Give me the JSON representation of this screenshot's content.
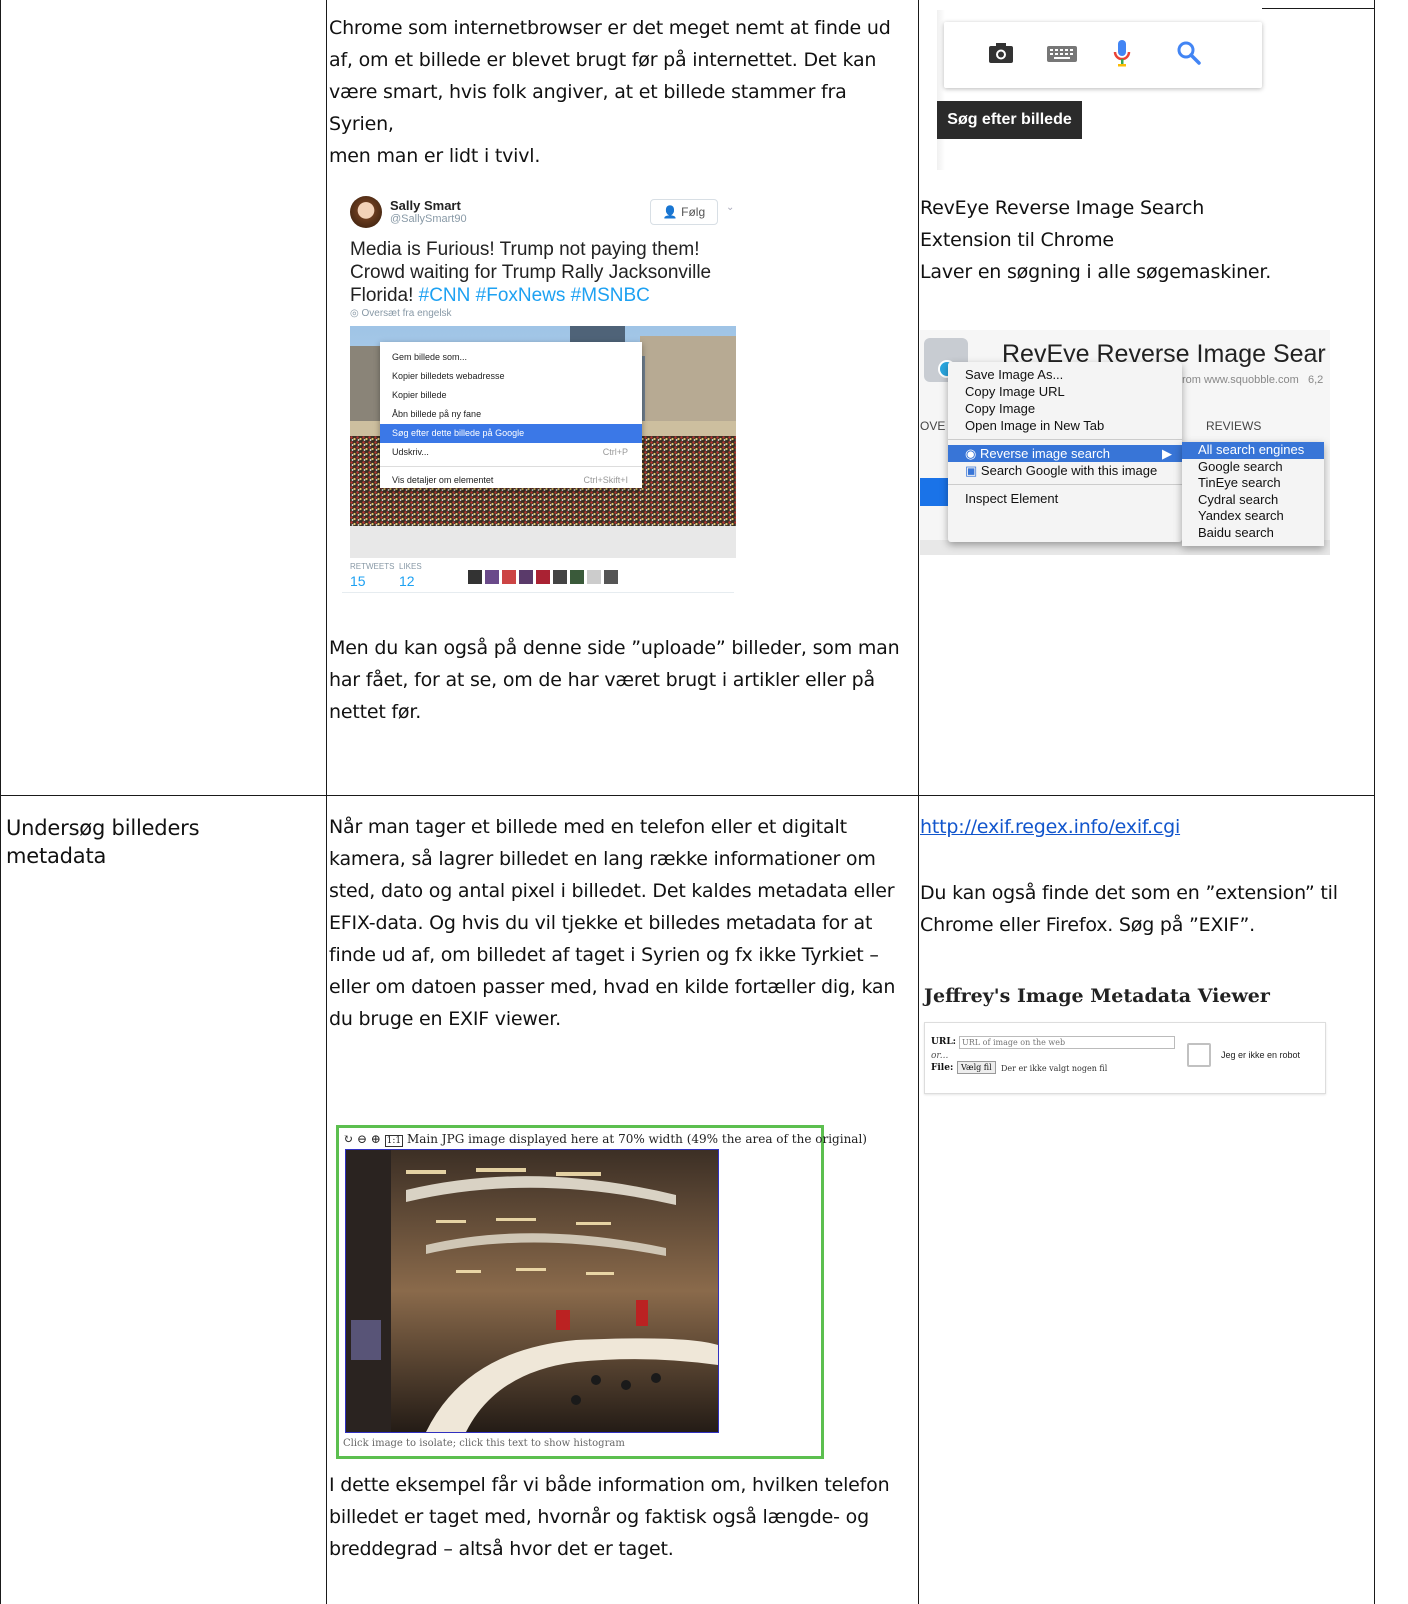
{
  "row1": {
    "intro_text": [
      "Chrome som internetbrowser er det meget nemt at finde ud",
      "af, om et billede er blevet brugt før på internettet. Det kan",
      "være smart, hvis folk angiver, at et billede stammer fra Syrien,",
      "men man er lidt i tvivl."
    ],
    "upload_text": [
      "Men du kan også på denne side ”uploade” billeder, som man",
      "har fået, for at se, om de har været brugt i artikler eller på",
      "nettet før."
    ],
    "tweet": {
      "name": "Sally Smart",
      "handle": "@SallySmart90",
      "follow_label": "Følg",
      "text_plain": "Media is Furious! Trump not paying them! Crowd waiting for Trump Rally Jacksonville Florida!",
      "hashtags": "#CNN #FoxNews #MSNBC",
      "translate_label": "Oversæt fra engelsk",
      "retweets_label": "RETWEETS",
      "likes_label": "LIKES",
      "retweets": "15",
      "likes": "12",
      "context_menu": [
        {
          "label": "Gem billede som...",
          "shortcut": ""
        },
        {
          "label": "Kopier billedets webadresse",
          "shortcut": ""
        },
        {
          "label": "Kopier billede",
          "shortcut": ""
        },
        {
          "label": "Åbn billede på ny fane",
          "shortcut": ""
        },
        {
          "label": "Søg efter dette billede på Google",
          "shortcut": "",
          "selected": true
        },
        {
          "label": "Udskriv...",
          "shortcut": "Ctrl+P"
        },
        {
          "label": "Vis detaljer om elementet",
          "shortcut": "Ctrl+Skift+I"
        }
      ]
    },
    "search_tooltip": "Søg efter billede",
    "reveye_title": "RevEye Reverse Image Search",
    "reveye_sub1": "Extension til Chrome",
    "reveye_sub2": "Laver en søgning i alle søgemaskiner.",
    "reveye_shot": {
      "header_title": "RevEye Reverse Image Sear",
      "from_text": "rom www.squobble.com",
      "count_text": "6,2",
      "tab_over": "OVE",
      "tab_reviews": "REVIEWS",
      "menu": [
        "Save Image As...",
        "Copy Image URL",
        "Copy Image",
        "Open Image in New Tab"
      ],
      "reverse_label": "Reverse image search",
      "google_item": "Search Google with this image",
      "inspect": "Inspect Element",
      "submenu": [
        "All search engines",
        "Google search",
        "TinEye search",
        "Cydral search",
        "Yandex search",
        "Baidu search"
      ]
    }
  },
  "row2": {
    "heading_line1": "Undersøg billeders",
    "heading_line2": "metadata",
    "body_text": [
      "Når man tager et billede med en telefon eller et digitalt",
      "kamera, så lagrer billedet en lang række informationer om",
      "sted, dato og antal pixel i billedet. Det kaldes metadata eller",
      "EFIX-data. Og hvis du vil tjekke et billedes metadata for at",
      "finde ud af, om billedet af taget i Syrien og fx ikke Tyrkiet –",
      "eller om datoen passer med, hvad en kilde fortæller dig, kan",
      "du bruge en EXIF viewer."
    ],
    "exif_toolbar": "Main JPG image displayed here at 70% width (49% the area of the original)",
    "exif_caption": "Click image to isolate; click this text to show histogram",
    "example_text": [
      "I dette eksempel får vi både information om, hvilken telefon",
      "billedet er taget med, hvornår og faktisk også længde- og",
      "breddegrad – altså hvor det er taget."
    ],
    "link": "http://exif.regex.info/exif.cgi",
    "ext_text": [
      "Du kan også finde det som en ”extension” til",
      "Chrome eller Firefox. Søg på ”EXIF”."
    ],
    "jeffrey_title": "Jeffrey's Image Metadata Viewer",
    "form": {
      "url_label": "URL:",
      "url_placeholder": "URL of image on the web",
      "or_label": "or...",
      "file_label": "File:",
      "file_button": "Vælg fil",
      "file_status": "Der er ikke valgt nogen fil",
      "captcha_label": "Jeg er ikke en robot"
    }
  }
}
